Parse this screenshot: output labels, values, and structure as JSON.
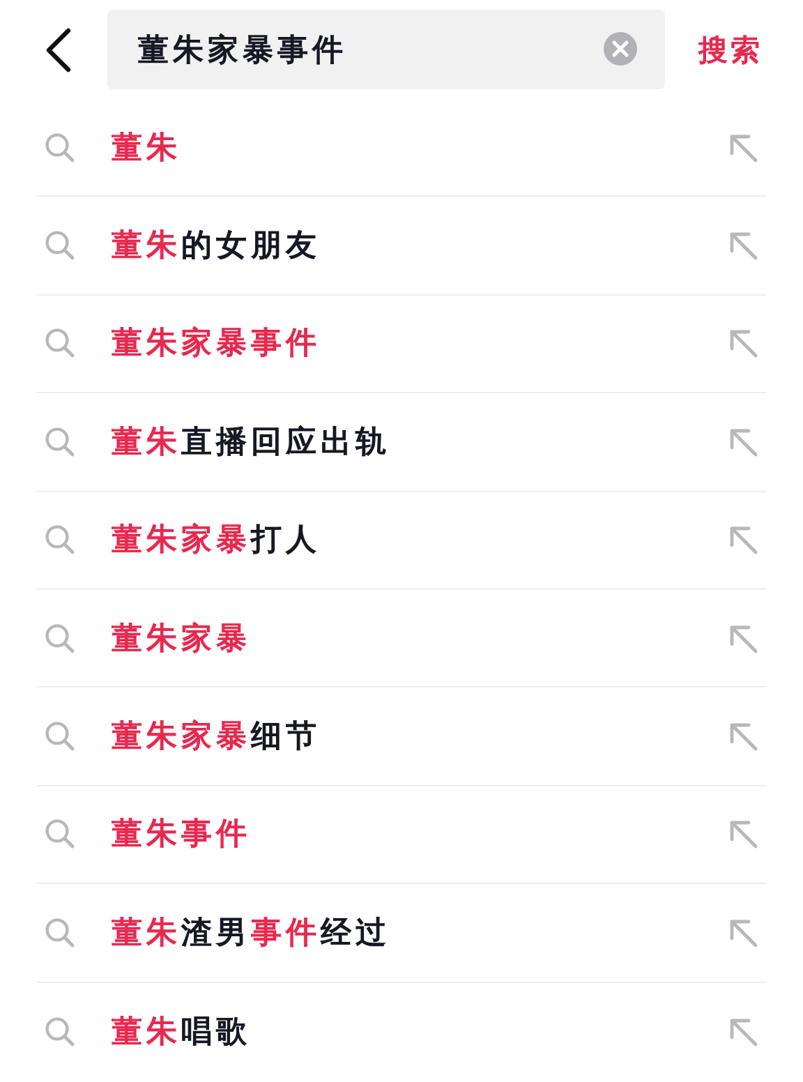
{
  "search_bar": {
    "value": "董朱家暴事件",
    "button": "搜索"
  },
  "suggestions": [
    {
      "segments": [
        {
          "text": "董朱",
          "highlight": true
        }
      ]
    },
    {
      "segments": [
        {
          "text": "董朱",
          "highlight": true
        },
        {
          "text": "的女朋友",
          "highlight": false
        }
      ]
    },
    {
      "segments": [
        {
          "text": "董朱家暴事件",
          "highlight": true
        }
      ]
    },
    {
      "segments": [
        {
          "text": "董朱",
          "highlight": true
        },
        {
          "text": "直播回应出轨",
          "highlight": false
        }
      ]
    },
    {
      "segments": [
        {
          "text": "董朱家暴",
          "highlight": true
        },
        {
          "text": "打人",
          "highlight": false
        }
      ]
    },
    {
      "segments": [
        {
          "text": "董朱家暴",
          "highlight": true
        }
      ]
    },
    {
      "segments": [
        {
          "text": "董朱家暴",
          "highlight": true
        },
        {
          "text": "细节",
          "highlight": false
        }
      ]
    },
    {
      "segments": [
        {
          "text": "董朱事件",
          "highlight": true
        }
      ]
    },
    {
      "segments": [
        {
          "text": "董朱",
          "highlight": true
        },
        {
          "text": "渣男",
          "highlight": false
        },
        {
          "text": "事件",
          "highlight": true
        },
        {
          "text": "经过",
          "highlight": false
        }
      ]
    },
    {
      "segments": [
        {
          "text": "董朱",
          "highlight": true
        },
        {
          "text": "唱歌",
          "highlight": false
        }
      ]
    }
  ]
}
